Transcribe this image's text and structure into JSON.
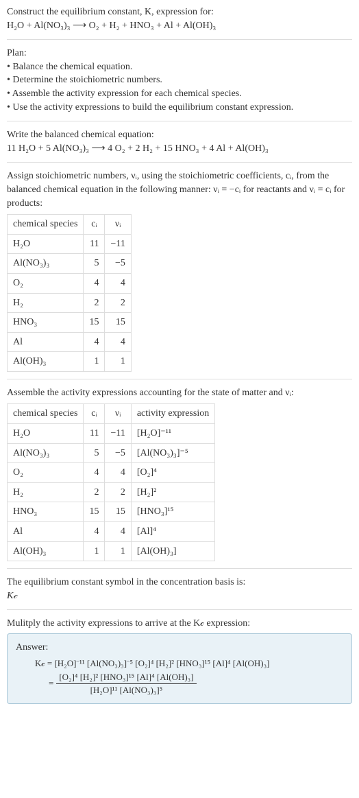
{
  "intro": {
    "line1": "Construct the equilibrium constant, K, expression for:",
    "equation": "H₂O + Al(NO₃)₃  ⟶  O₂ + H₂ + HNO₃ + Al + Al(OH)₃"
  },
  "plan": {
    "heading": "Plan:",
    "items": [
      "• Balance the chemical equation.",
      "• Determine the stoichiometric numbers.",
      "• Assemble the activity expression for each chemical species.",
      "• Use the activity expressions to build the equilibrium constant expression."
    ]
  },
  "balanced": {
    "heading": "Write the balanced chemical equation:",
    "equation": "11 H₂O + 5 Al(NO₃)₃  ⟶  4 O₂ + 2 H₂ + 15 HNO₃ + 4 Al + Al(OH)₃"
  },
  "stoich": {
    "text_a": "Assign stoichiometric numbers, νᵢ, using the stoichiometric coefficients, cᵢ, from the balanced chemical equation in the following manner: νᵢ = −cᵢ for reactants and νᵢ = cᵢ for products:",
    "headers": [
      "chemical species",
      "cᵢ",
      "νᵢ"
    ],
    "rows": [
      [
        "H₂O",
        "11",
        "−11"
      ],
      [
        "Al(NO₃)₃",
        "5",
        "−5"
      ],
      [
        "O₂",
        "4",
        "4"
      ],
      [
        "H₂",
        "2",
        "2"
      ],
      [
        "HNO₃",
        "15",
        "15"
      ],
      [
        "Al",
        "4",
        "4"
      ],
      [
        "Al(OH)₃",
        "1",
        "1"
      ]
    ]
  },
  "activity": {
    "text": "Assemble the activity expressions accounting for the state of matter and νᵢ:",
    "headers": [
      "chemical species",
      "cᵢ",
      "νᵢ",
      "activity expression"
    ],
    "rows": [
      [
        "H₂O",
        "11",
        "−11",
        "[H₂O]⁻¹¹"
      ],
      [
        "Al(NO₃)₃",
        "5",
        "−5",
        "[Al(NO₃)₃]⁻⁵"
      ],
      [
        "O₂",
        "4",
        "4",
        "[O₂]⁴"
      ],
      [
        "H₂",
        "2",
        "2",
        "[H₂]²"
      ],
      [
        "HNO₃",
        "15",
        "15",
        "[HNO₃]¹⁵"
      ],
      [
        "Al",
        "4",
        "4",
        "[Al]⁴"
      ],
      [
        "Al(OH)₃",
        "1",
        "1",
        "[Al(OH)₃]"
      ]
    ]
  },
  "symbol": {
    "line1": "The equilibrium constant symbol in the concentration basis is:",
    "line2": "K𝒸"
  },
  "multiply": {
    "text": "Mulitply the activity expressions to arrive at the K𝒸 expression:"
  },
  "answer": {
    "label": "Answer:",
    "kc_inline": "K𝒸 = [H₂O]⁻¹¹ [Al(NO₃)₃]⁻⁵ [O₂]⁴ [H₂]² [HNO₃]¹⁵ [Al]⁴ [Al(OH)₃]",
    "frac_eq": "=",
    "frac_num": "[O₂]⁴ [H₂]² [HNO₃]¹⁵ [Al]⁴ [Al(OH)₃]",
    "frac_den": "[H₂O]¹¹ [Al(NO₃)₃]⁵"
  }
}
